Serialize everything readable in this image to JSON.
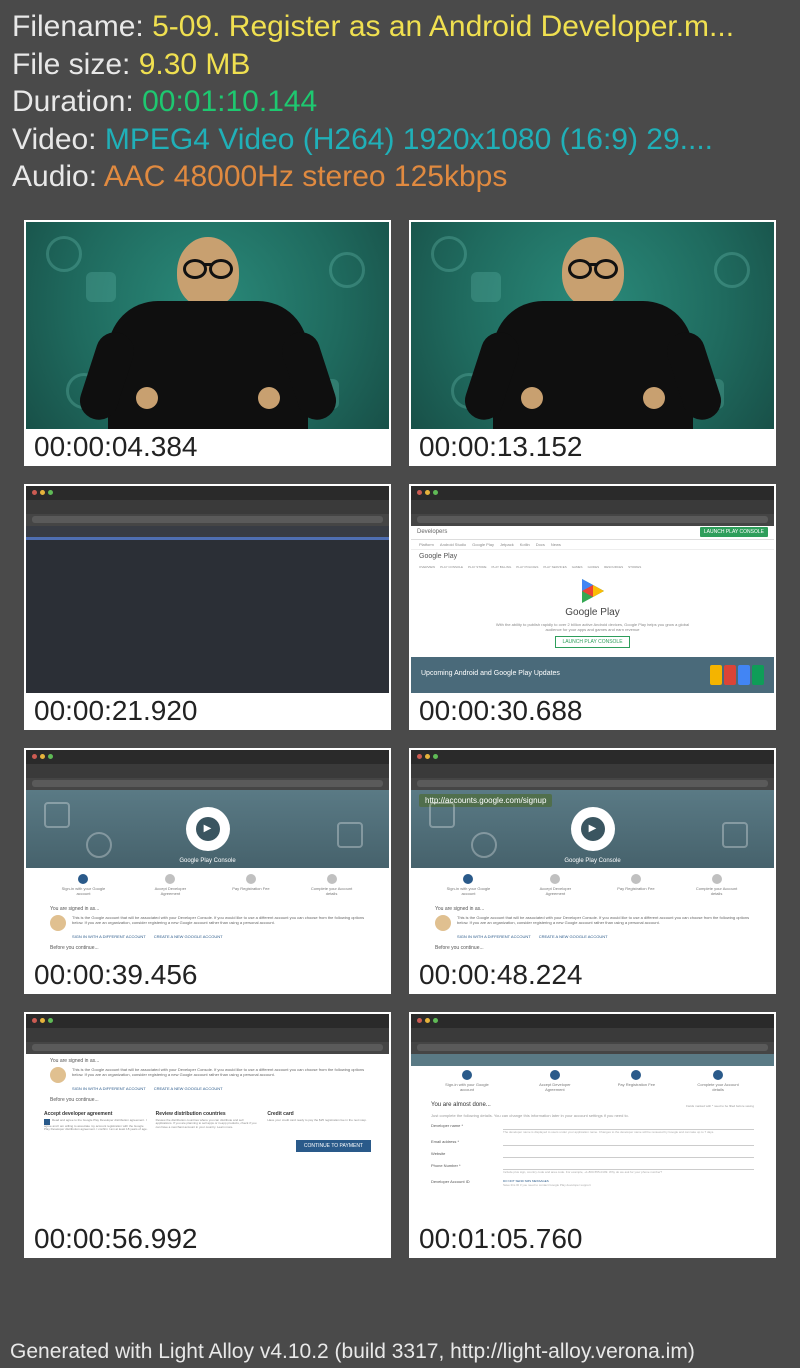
{
  "info": {
    "filename_label": "Filename: ",
    "filename_value": "5-09. Register as an Android Developer.m...",
    "filesize_label": "File size: ",
    "filesize_value": "9.30 MB",
    "duration_label": "Duration: ",
    "duration_value": "00:01:10.144",
    "video_label": "Video: ",
    "video_value": "MPEG4 Video (H264) 1920x1080 (16:9) 29....",
    "audio_label": "Audio: ",
    "audio_value": "AAC 48000Hz stereo 125kbps"
  },
  "timestamps": [
    "00:00:04.384",
    "00:00:13.152",
    "00:00:21.920",
    "00:00:30.688",
    "00:00:39.456",
    "00:00:48.224",
    "00:00:56.992",
    "00:01:05.760"
  ],
  "frame4": {
    "dev": "Developers",
    "launch": "LAUNCH PLAY CONSOLE",
    "title_small": "Google Play",
    "nav": [
      "Platform",
      "Android Studio",
      "Google Play",
      "Jetpack",
      "Kotlin",
      "Docs",
      "News"
    ],
    "subnav": [
      "OVERVIEW",
      "PLAY CONSOLE",
      "PLAY STORE",
      "PLAY BILLING",
      "PLAY POLICIES",
      "PLAY SERVICES",
      "GAMES",
      "GUIDES",
      "RESOURCES",
      "STORIES"
    ],
    "hero_title": "Google Play",
    "hero_sub": "With the ability to publish rapidly to over 2 billion active Android devices, Google Play helps you grow a global audience for your apps and games and earn revenue",
    "hero_btn": "LAUNCH PLAY CONSOLE",
    "card_title": "Upcoming Android and Google Play Updates"
  },
  "console": {
    "hero_label": "Google Play Console",
    "steps": [
      "Sign-in with your Google account",
      "Accept Developer Agreement",
      "Pay Registration Fee",
      "Complete your Account details"
    ],
    "signedin": "You are signed in as...",
    "desc": "This is the Google account that will be associated with your Developer Console. If you would like to use a different account you can choose from the following options below. If you are an organization, consider registering a new Google account rather than using a personal account.",
    "link1": "SIGN IN WITH A DIFFERENT ACCOUNT",
    "link2": "CREATE A NEW GOOGLE ACCOUNT",
    "before": "Before you continue...",
    "overlay_url": "http://accounts.google.com/signup"
  },
  "frame7": {
    "cols": [
      {
        "title": "Accept developer agreement",
        "text": "Read and agree to the Google Play Developer distribution agreement. I agree and I am willing to associate my account registration with the Google Play Developer distribution agreement. I confirm I am at least 18 years of age."
      },
      {
        "title": "Review distribution countries",
        "text": "Review the distribution countries where you can distribute and sell applications. If you are planning to sell apps or in-app products, check if you can have a merchant account in your country. Learn more."
      },
      {
        "title": "Credit card",
        "text": "Have your credit card ready to pay the $25 registration fee in the next step."
      }
    ],
    "btn": "CONTINUE TO PAYMENT"
  },
  "frame8": {
    "title": "You are almost done...",
    "sub": "Just complete the following details. You can change this information later in your account settings if you need to.",
    "badge": "Fields marked with * need to be filled before saving",
    "rows": [
      {
        "label": "Developer name *",
        "hint": "The developer name is displayed to users under your application name. Changes to the developer name will be reviewed by Google and can take up to 7 days."
      },
      {
        "label": "Email address *",
        "hint": ""
      },
      {
        "label": "Website",
        "hint": ""
      },
      {
        "label": "Phone Number *",
        "hint": "Include plus sign, country code and area code. For example, +1-800-555-0199. Why do we ask for your phone number?"
      },
      {
        "label": "Developer Account ID",
        "hint": "Save this ID if you need to contact Google Play developer support"
      },
      {
        "label": "",
        "hint": "DO NOT SEND SMS MESSAGES"
      }
    ]
  },
  "footer": "Generated with Light Alloy v4.10.2 (build 3317, http://light-alloy.verona.im)"
}
